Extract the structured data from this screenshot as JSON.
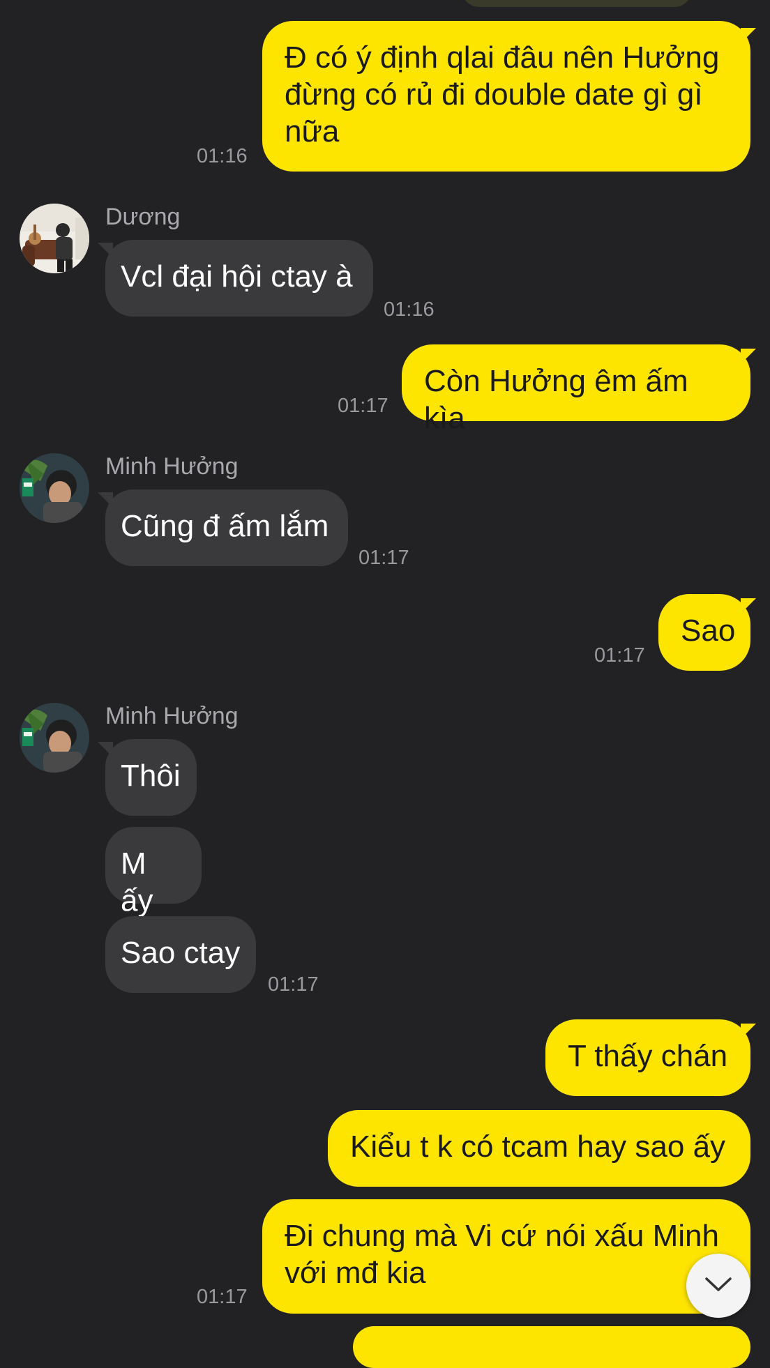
{
  "chat": {
    "messages": [
      {
        "sender": "me",
        "text": "Đ có ý định qlai đâu nên Hưởng đừng có rủ đi double date gì gì nữa",
        "time": "01:16"
      },
      {
        "sender": "Dương",
        "text": "Vcl đại hội ctay à",
        "time": "01:16"
      },
      {
        "sender": "me",
        "text": "Còn Hưởng êm ấm kìa",
        "time": "01:17"
      },
      {
        "sender": "Minh Hưởng",
        "text": "Cũng đ ấm lắm",
        "time": "01:17"
      },
      {
        "sender": "me",
        "text": "Sao",
        "time": "01:17"
      },
      {
        "sender": "Minh Hưởng",
        "text": "Thôi"
      },
      {
        "sender": "Minh Hưởng",
        "text": "M ấy"
      },
      {
        "sender": "Minh Hưởng",
        "text": "Sao ctay",
        "time": "01:17"
      },
      {
        "sender": "me",
        "text": "T thấy chán"
      },
      {
        "sender": "me",
        "text": "Kiểu t k có tcam hay sao ấy"
      },
      {
        "sender": "me",
        "text": "Đi chung mà Vi cứ nói xấu Minh với mđ kia",
        "time": "01:17"
      }
    ]
  },
  "colors": {
    "background": "#222224",
    "my_bubble": "#fee500",
    "their_bubble": "#3a3a3c",
    "timestamp": "#9a9a9e"
  },
  "icons": {
    "scroll_down": "chevron-down-icon"
  }
}
